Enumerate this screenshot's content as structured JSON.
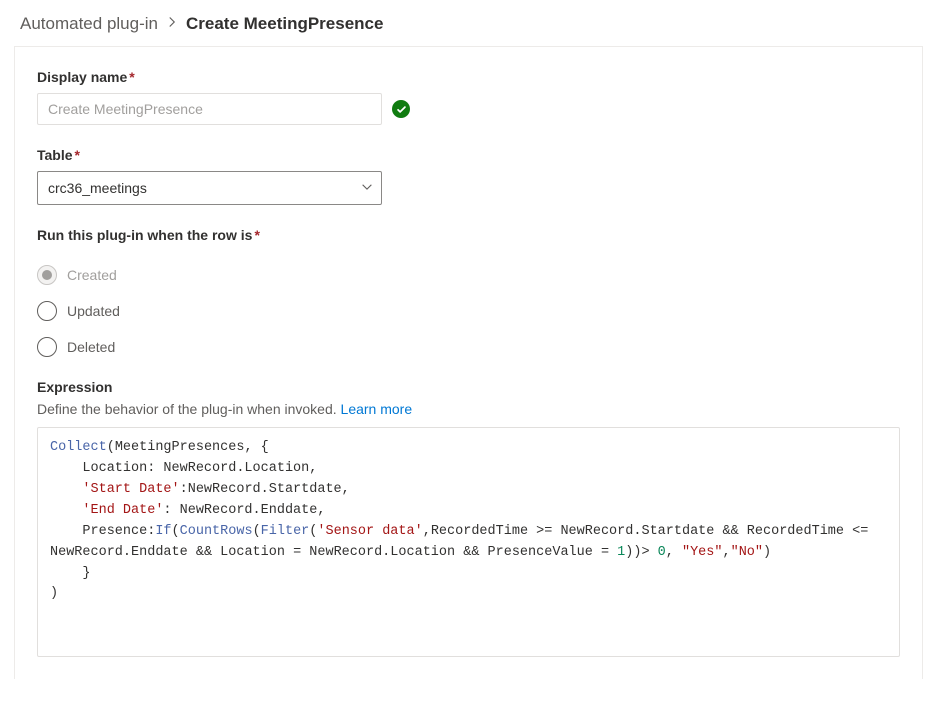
{
  "breadcrumb": {
    "parent": "Automated plug-in",
    "current": "Create MeetingPresence"
  },
  "form": {
    "display_name": {
      "label": "Display name",
      "placeholder": "Create MeetingPresence",
      "value": ""
    },
    "table": {
      "label": "Table",
      "value": "crc36_meetings"
    },
    "run_when": {
      "label": "Run this plug-in when the row is",
      "options": {
        "created": "Created",
        "updated": "Updated",
        "deleted": "Deleted"
      },
      "selected": "created"
    },
    "expression": {
      "heading": "Expression",
      "subtext": "Define the behavior of the plug-in when invoked.",
      "learn_more": "Learn more",
      "code": {
        "fn_collect": "Collect",
        "id_meetingpresences": "MeetingPresences",
        "prop_location": "Location",
        "val_location": "NewRecord.Location",
        "prop_start": "'Start Date'",
        "val_start": "NewRecord.Startdate",
        "prop_end": "'End Date'",
        "val_end": "NewRecord.Enddate",
        "prop_presence": "Presence",
        "fn_if": "If",
        "fn_countrows": "CountRows",
        "fn_filter": "Filter",
        "str_sensor": "'Sensor data'",
        "cond1a": "RecordedTime >= NewRecord.Startdate",
        "cond_and": "&&",
        "cond1b": "RecordedTime <= NewRecord.Enddate",
        "cond2": "Location = NewRecord.Location",
        "cond3a": "PresenceValue = ",
        "num1": "1",
        "gt": "> ",
        "num0": "0",
        "str_yes": "\"Yes\"",
        "str_no": "\"No\""
      }
    }
  }
}
